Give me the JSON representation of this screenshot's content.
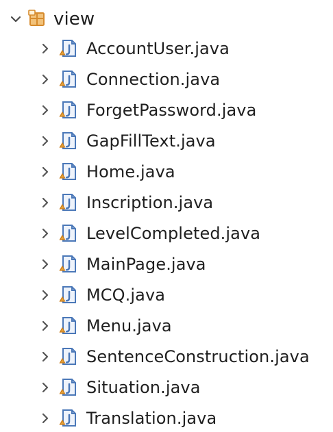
{
  "tree": {
    "root": {
      "label": "view",
      "icon": "package-icon",
      "expanded": true
    },
    "items": [
      {
        "label": "AccountUser.java",
        "icon": "java-file-icon"
      },
      {
        "label": "Connection.java",
        "icon": "java-file-icon"
      },
      {
        "label": "ForgetPassword.java",
        "icon": "java-file-icon"
      },
      {
        "label": "GapFillText.java",
        "icon": "java-file-icon"
      },
      {
        "label": "Home.java",
        "icon": "java-file-icon"
      },
      {
        "label": "Inscription.java",
        "icon": "java-file-icon"
      },
      {
        "label": "LevelCompleted.java",
        "icon": "java-file-icon"
      },
      {
        "label": "MainPage.java",
        "icon": "java-file-icon"
      },
      {
        "label": "MCQ.java",
        "icon": "java-file-icon"
      },
      {
        "label": "Menu.java",
        "icon": "java-file-icon"
      },
      {
        "label": "SentenceConstruction.java",
        "icon": "java-file-icon"
      },
      {
        "label": "Situation.java",
        "icon": "java-file-icon"
      },
      {
        "label": "Translation.java",
        "icon": "java-file-icon"
      }
    ]
  },
  "colors": {
    "text": "#1f1f1f",
    "chevron": "#555555",
    "package_orange": "#d68b2d",
    "package_light": "#f2c27a",
    "file_blue": "#4b78b8",
    "file_fill": "#eef3fb",
    "file_warning": "#e5a13a"
  }
}
